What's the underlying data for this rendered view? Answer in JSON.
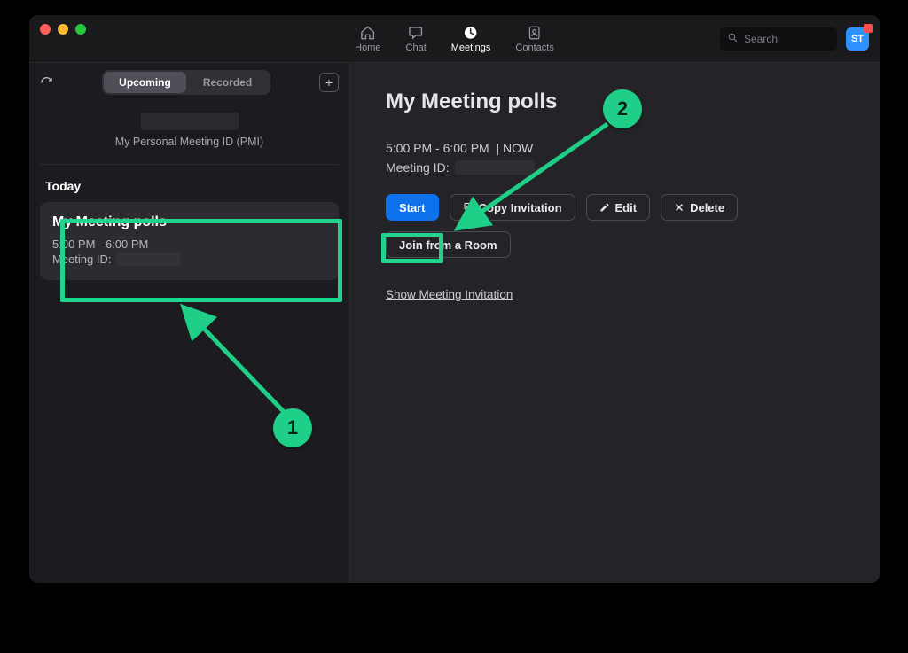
{
  "nav": {
    "home": "Home",
    "chat": "Chat",
    "meetings": "Meetings",
    "contacts": "Contacts"
  },
  "search": {
    "placeholder": "Search"
  },
  "avatar": {
    "initials": "ST"
  },
  "sidebar": {
    "tab_upcoming": "Upcoming",
    "tab_recorded": "Recorded",
    "pmi_label": "My Personal Meeting ID (PMI)",
    "today_heading": "Today",
    "card": {
      "title": "My Meeting polls",
      "time": "5:00 PM - 6:00 PM",
      "meeting_id_label": "Meeting ID:"
    }
  },
  "detail": {
    "title": "My Meeting polls",
    "time_range": "5:00 PM - 6:00 PM",
    "now_text": "| NOW",
    "meeting_id_label": "Meeting ID:",
    "btn_start": "Start",
    "btn_copy": "Copy Invitation",
    "btn_edit": "Edit",
    "btn_delete": "Delete",
    "btn_join_room": "Join from a Room",
    "link_show_invitation": "Show Meeting Invitation"
  },
  "annotations": {
    "step1": "1",
    "step2": "2"
  }
}
